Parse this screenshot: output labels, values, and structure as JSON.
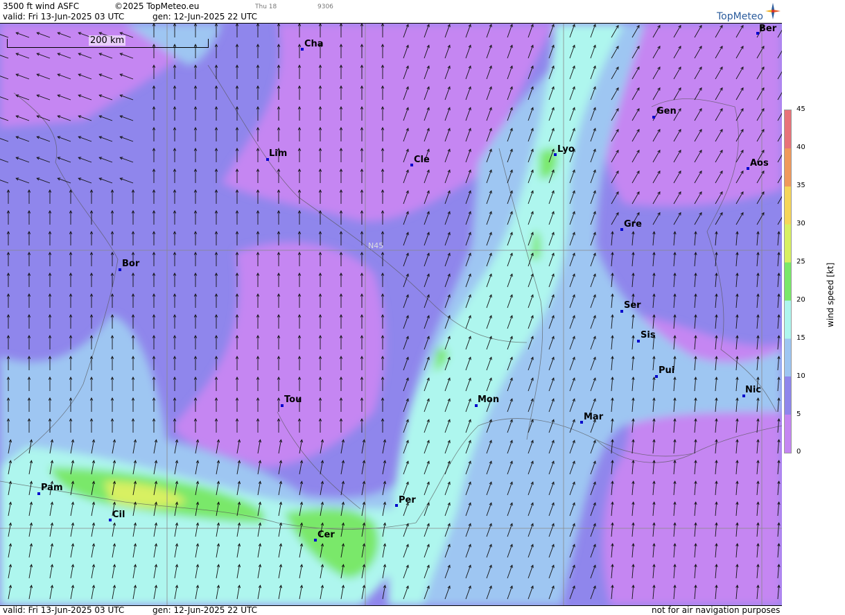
{
  "header": {
    "product": "3500 ft wind ASFC",
    "copyright": "©2025 TopMeteo.eu",
    "day_tag": "Thu 18",
    "code_tag": "9306",
    "valid": "valid:  Fri  13-Jun-2025  03 UTC",
    "gen": "gen: 12-Jun-2025 22 UTC"
  },
  "logo": {
    "text": "TopMeteo",
    "icon": "compass-star-icon"
  },
  "map": {
    "scale_label": "200 km",
    "latitude_label": "N45",
    "cities": [
      {
        "label": "Cha"
      },
      {
        "label": "Ber"
      },
      {
        "label": "Lim"
      },
      {
        "label": "Cle"
      },
      {
        "label": "Lyo"
      },
      {
        "label": "Gen"
      },
      {
        "label": "Aos"
      },
      {
        "label": "Gre"
      },
      {
        "label": "Bor"
      },
      {
        "label": "Ser"
      },
      {
        "label": "Sis"
      },
      {
        "label": "Pui"
      },
      {
        "label": "Tou"
      },
      {
        "label": "Mon"
      },
      {
        "label": "Mar"
      },
      {
        "label": "Nic"
      },
      {
        "label": "Pam"
      },
      {
        "label": "Cil"
      },
      {
        "label": "Per"
      },
      {
        "label": "Cer"
      }
    ]
  },
  "legend": {
    "title": "wind speed [kt]",
    "ticks": [
      "45",
      "40",
      "35",
      "30",
      "25",
      "20",
      "15",
      "10",
      "5",
      "0"
    ],
    "colors": [
      "#e8737a",
      "#f09a5c",
      "#f6d65a",
      "#d8f062",
      "#7ae86a",
      "#aef6ee",
      "#9ec6f2",
      "#8f86ec",
      "#c586f2"
    ]
  },
  "footer": {
    "valid": "valid:  Fri  13-Jun-2025  03 UTC",
    "gen": "gen: 12-Jun-2025 22 UTC",
    "note": "not for air navigation purposes"
  }
}
